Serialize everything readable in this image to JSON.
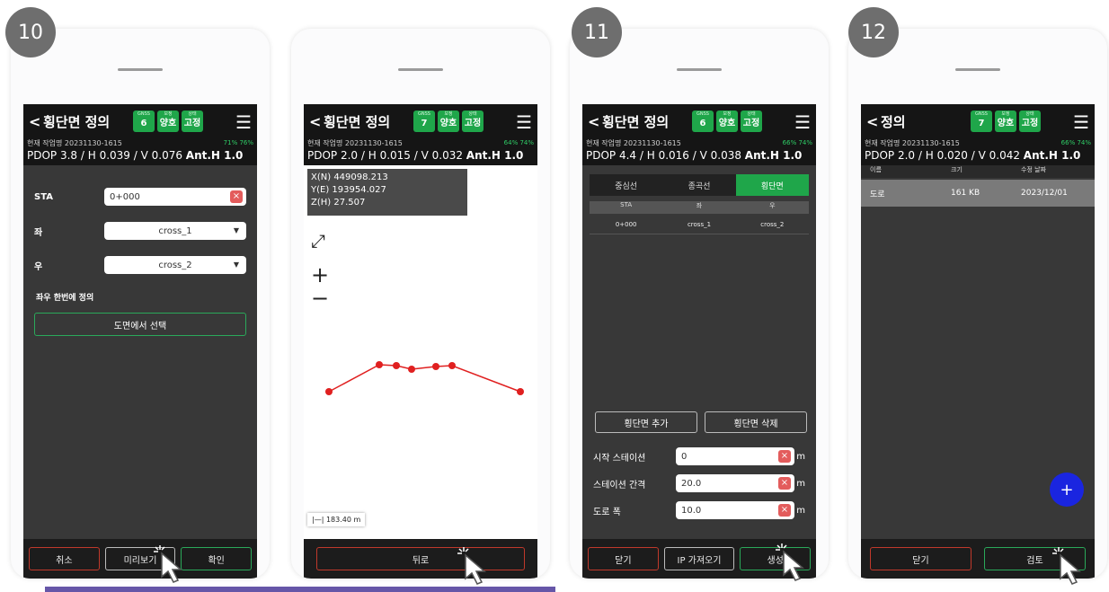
{
  "common": {
    "back": "<",
    "menu": "☰",
    "badge_small": "GNSS",
    "badge_small2": "보정",
    "badge_small3": "상태"
  },
  "screen10": {
    "step": "10",
    "title": "횡단면 정의",
    "sats": "6",
    "badge2": "양호",
    "badge3": "고정",
    "job": "현재 작업명 20231130-1615",
    "battery": "71%  76%",
    "pdop": "PDOP 3.8 / H 0.039 / V 0.076",
    "anth": "Ant.H 1.0",
    "sta_label": "STA",
    "sta_value": "0+000",
    "left_label": "좌",
    "left_value": "cross_1",
    "right_label": "우",
    "right_value": "cross_2",
    "both_label": "좌우 한번에 정의",
    "select_map": "도면에서 선택",
    "btn_cancel": "취소",
    "btn_preview": "미리보기",
    "btn_ok": "확인"
  },
  "screen10b": {
    "title": "횡단면 정의",
    "sats": "7",
    "badge2": "양호",
    "badge3": "고정",
    "job": "현재 작업명 20231130-1615",
    "battery": "64%  74%",
    "pdop": "PDOP 2.0 / H 0.015 / V 0.032",
    "anth": "Ant.H 1.0",
    "coord_n": "X(N) 449098.213",
    "coord_e": "Y(E) 193954.027",
    "coord_z": "Z(H) 27.507",
    "zoom_in": "+",
    "zoom_out": "−",
    "scale": "183.40 m",
    "btn_back": "뒤로"
  },
  "screen11": {
    "step": "11",
    "title": "횡단면 정의",
    "sats": "6",
    "badge2": "양호",
    "badge3": "고정",
    "job": "현재 작업명 20231130-1615",
    "battery": "66%  74%",
    "pdop": "PDOP 4.4 / H 0.016 / V 0.038",
    "anth": "Ant.H 1.0",
    "tabs": [
      "중심선",
      "종곡선",
      "횡단면"
    ],
    "col_sta": "STA",
    "col_left": "좌",
    "col_right": "우",
    "row_sta": "0+000",
    "row_left": "cross_1",
    "row_right": "cross_2",
    "add": "횡단면 추가",
    "delete": "횡단면 삭제",
    "start_label": "시작 스테이션",
    "start_value": "0",
    "interval_label": "스테이션 간격",
    "interval_value": "20.0",
    "width_label": "도로 폭",
    "width_value": "10.0",
    "unit": "m",
    "btn_close": "닫기",
    "btn_ip": "IP 가져오기",
    "btn_create": "생성"
  },
  "screen12": {
    "step": "12",
    "title": "정의",
    "sats": "7",
    "badge2": "양호",
    "badge3": "고정",
    "job": "현재 작업명 20231130-1615",
    "battery": "66%  74%",
    "pdop": "PDOP 2.0 / H 0.020 / V 0.042",
    "anth": "Ant.H 1.0",
    "col_name": "이름",
    "col_size": "크기",
    "col_date": "수정 날짜",
    "file_name": "도로",
    "file_size": "161 KB",
    "file_date": "2023/12/01",
    "fab": "+",
    "btn_close": "닫기",
    "btn_review": "검토"
  },
  "colors": {
    "accent": "#1fa64a",
    "danger": "#c0392b",
    "fab": "#1a25e0",
    "underline": "#6656a8"
  }
}
